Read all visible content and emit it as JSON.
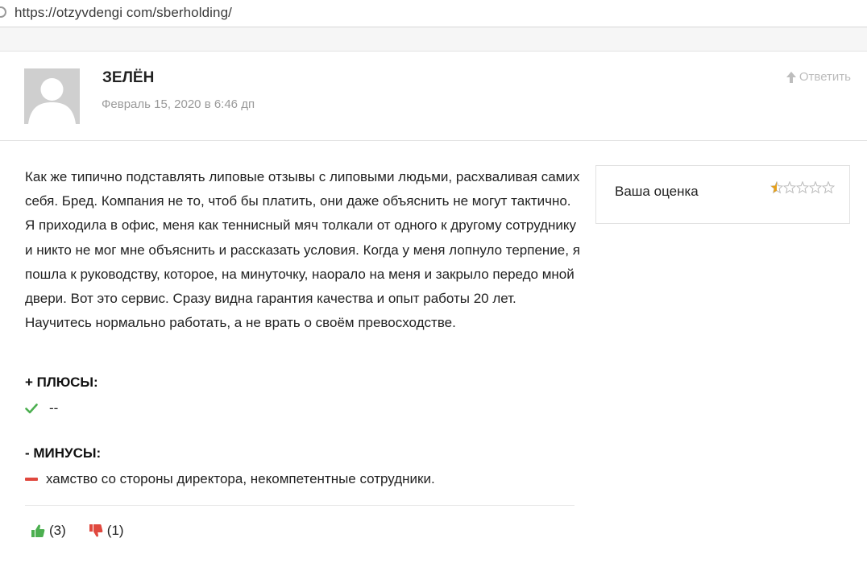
{
  "browser": {
    "url": "https://otzyvdengi com/sberholding/"
  },
  "comment": {
    "author": "ЗЕЛЁН",
    "date": "Февраль 15, 2020 в 6:46 дп",
    "reply_label": "Ответить",
    "text": "Как же типично подставлять липовые отзывы с липовыми людьми, расхваливая самих себя. Бред. Компания не то, чтоб бы платить, они даже объяснить не могут тактично. Я приходила в офис, меня как теннисный мяч толкали от одного к другому сотруднику и никто не мог мне объяснить и рассказать условия. Когда у меня лопнуло терпение, я пошла к руководству, которое, на минуточку, наорало на меня и закрыло передо мной двери. Вот это сервис. Сразу видна гарантия качества и опыт работы 20 лет. Научитесь нормально работать, а не врать о своём превосходстве.",
    "rating": {
      "label": "Ваша оценка",
      "value": 0.5,
      "max": 5,
      "star_color": "#e6a01a",
      "empty_star_color": "#bbbbbb"
    },
    "pros": {
      "title": "+ ПЛЮСЫ:",
      "items": [
        "--"
      ],
      "icon": "check-icon",
      "icon_color": "#4caf50"
    },
    "cons": {
      "title": "- МИНУСЫ:",
      "items": [
        "хамство со стороны директора, некомпетентные сотрудники."
      ],
      "icon": "minus-icon",
      "icon_color": "#e0483e"
    },
    "votes": {
      "likes": "(3)",
      "dislikes": "(1)",
      "like_color": "#4caf50",
      "dislike_color": "#e0483e"
    }
  }
}
